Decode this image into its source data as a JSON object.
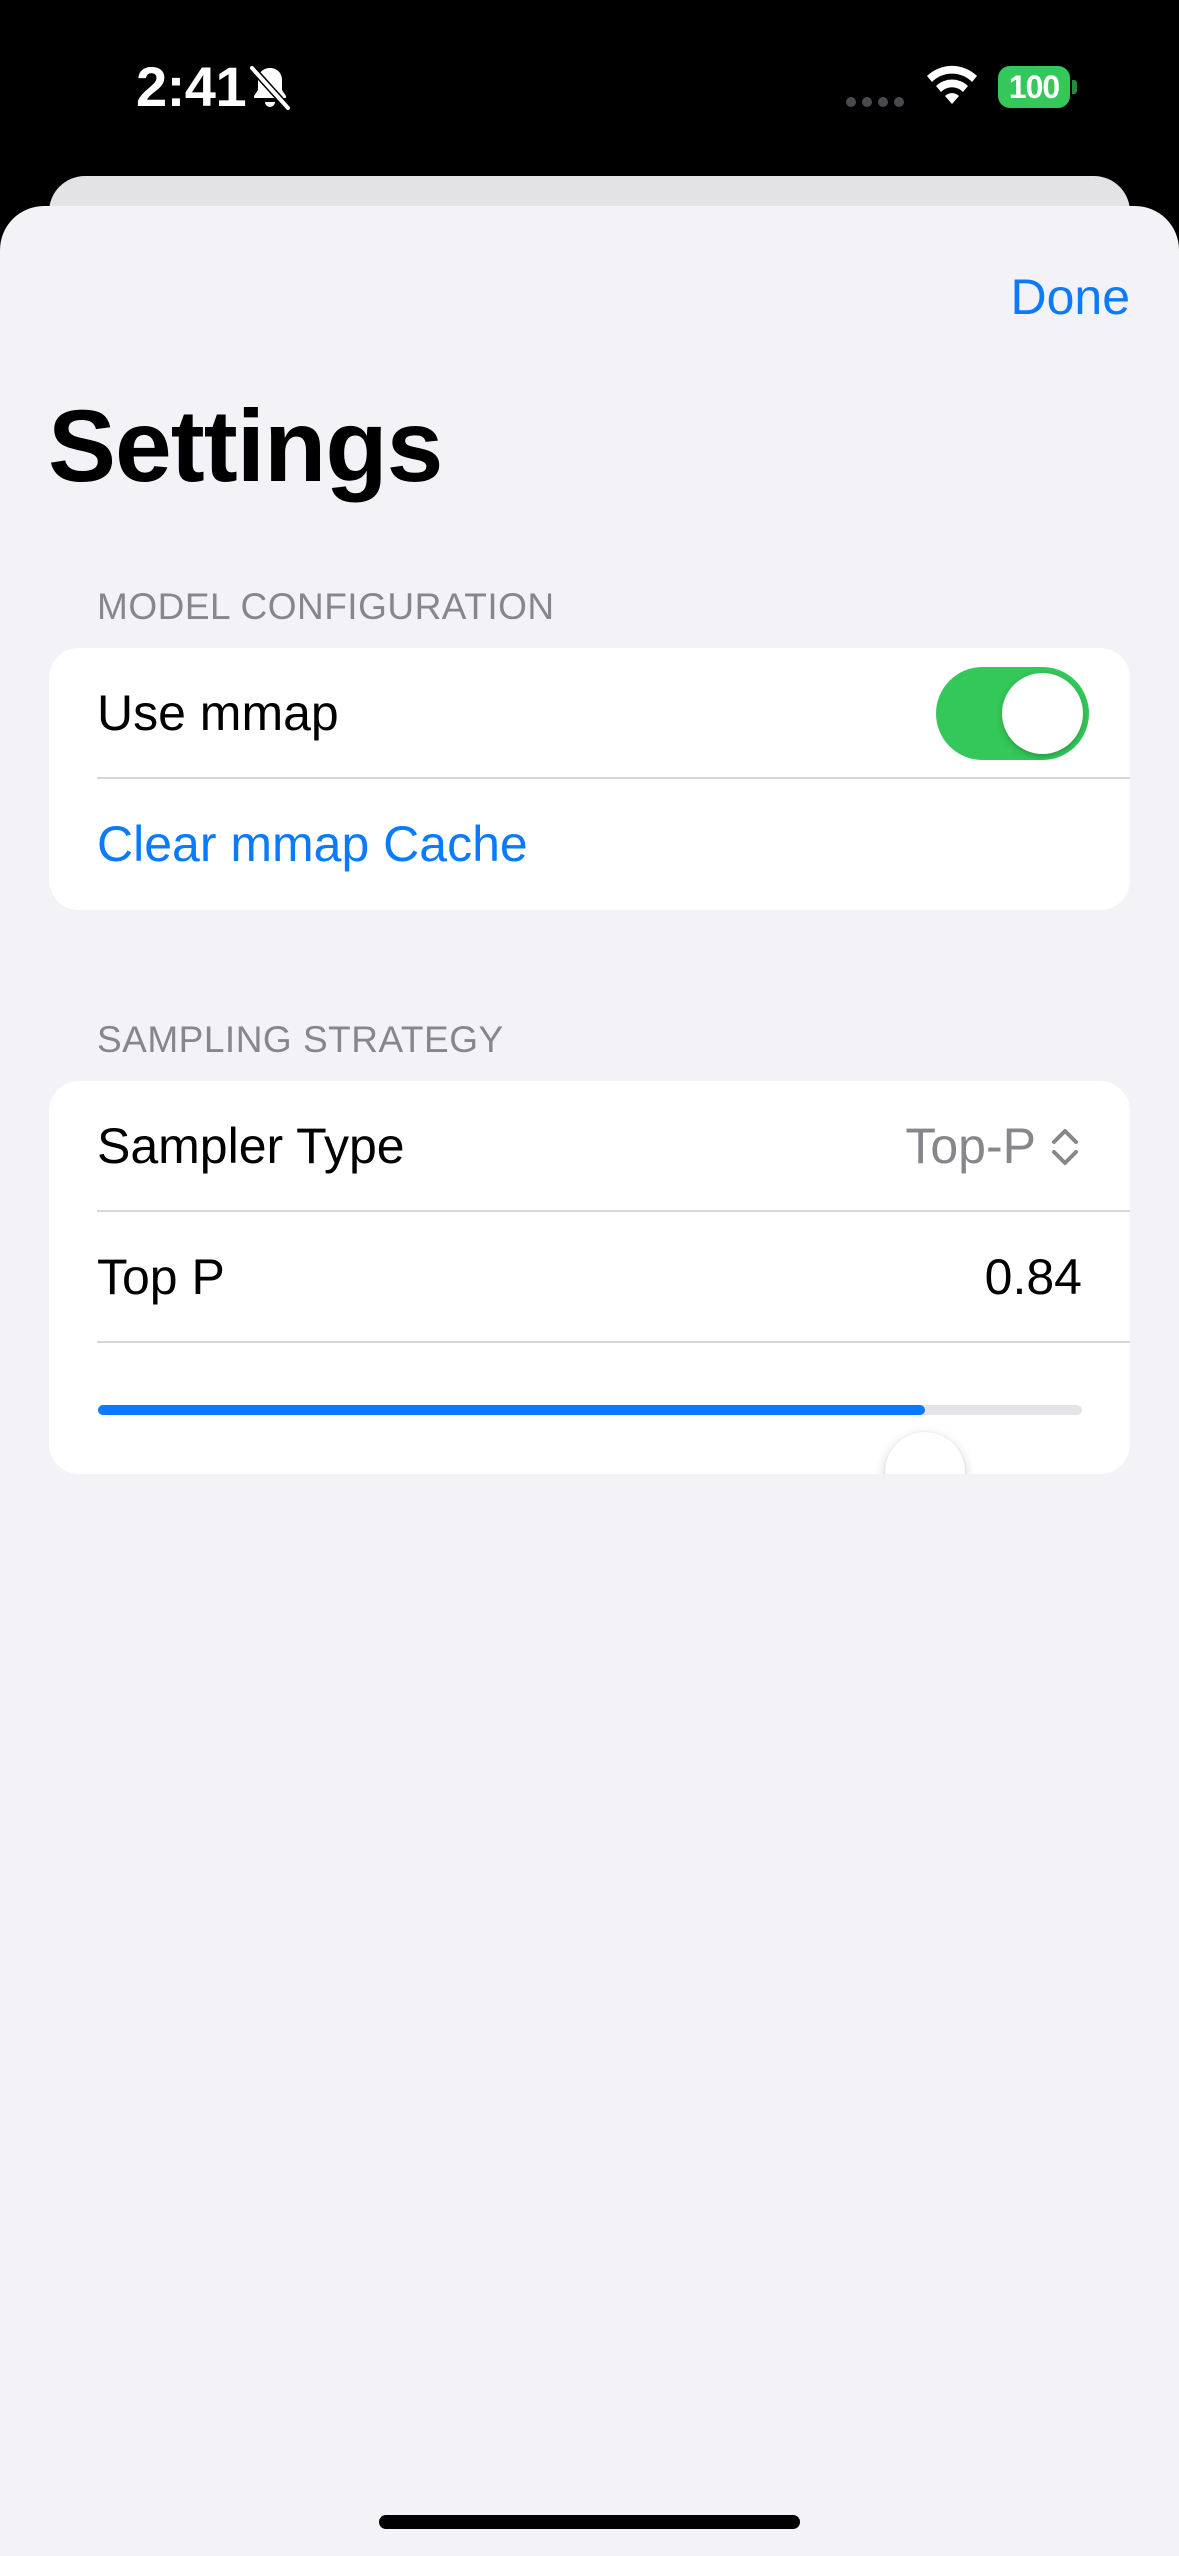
{
  "status_bar": {
    "time": "2:41",
    "battery_level": "100",
    "silent_mode": true,
    "accent_battery": "#34c759"
  },
  "nav": {
    "done_label": "Done"
  },
  "page": {
    "title": "Settings"
  },
  "model_configuration": {
    "header": "MODEL CONFIGURATION",
    "use_mmap_label": "Use mmap",
    "use_mmap_enabled": true,
    "clear_cache_label": "Clear mmap Cache"
  },
  "sampling_strategy": {
    "header": "SAMPLING STRATEGY",
    "sampler_type_label": "Sampler Type",
    "sampler_type_value": "Top-P",
    "top_p_label": "Top P",
    "top_p_value": "0.84",
    "top_p_fraction": 0.84
  },
  "colors": {
    "accent": "#0a7aff",
    "toggle_on": "#34c759",
    "background": "#f2f2f7",
    "secondary_text": "#86868b"
  },
  "icons": {
    "silent": "bell-slash-icon",
    "wifi": "wifi-icon",
    "cellular": "cellular-signal-icon",
    "picker": "chevron-up-down-icon"
  }
}
